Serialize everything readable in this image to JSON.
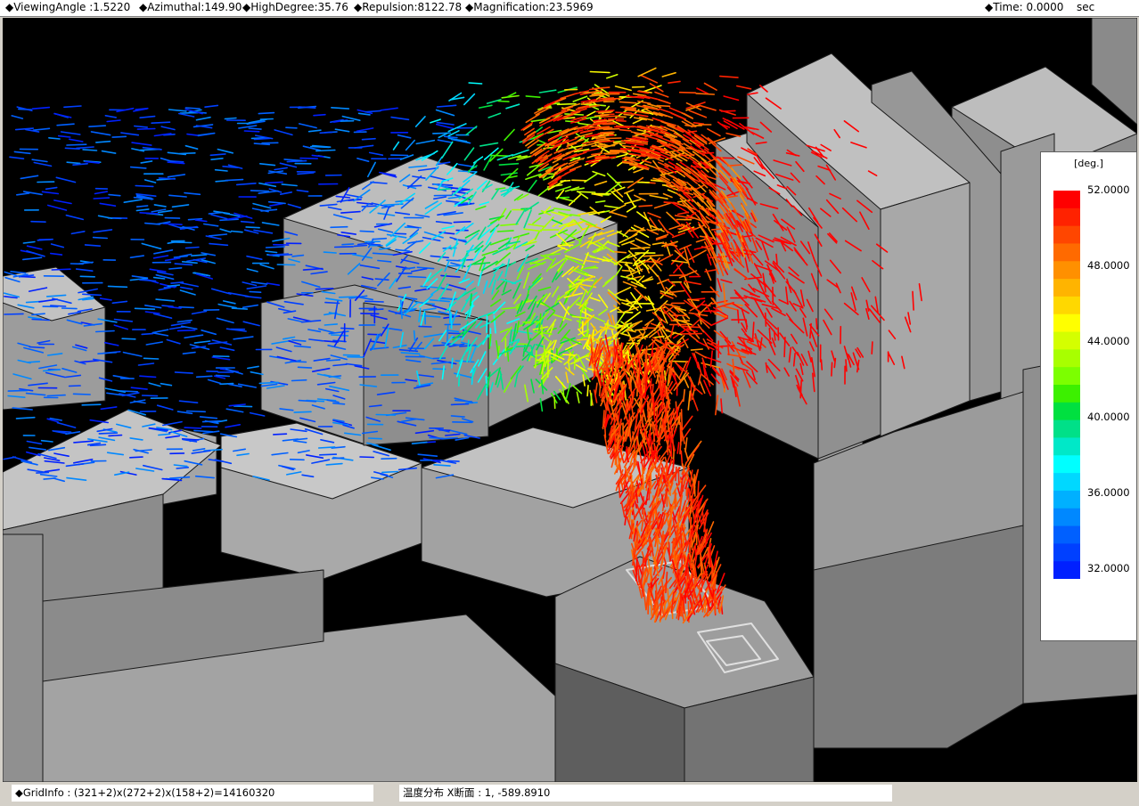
{
  "top_bar": {
    "viewing_angle": "◆ViewingAngle :1.5220",
    "azimuthal": "◆Azimuthal:149.90",
    "high_degree": "◆HighDegree:35.76",
    "repulsion": "◆Repulsion:8122.78",
    "magnification": "◆Magnification:23.5969",
    "time": "◆Time: 0.0000",
    "time_unit": "sec"
  },
  "legend": {
    "unit": "[deg.]",
    "min": 32,
    "max": 52,
    "labels": [
      "52.0000",
      "48.0000",
      "44.0000",
      "40.0000",
      "36.0000",
      "32.0000"
    ],
    "colors": [
      "#ff0000",
      "#ff2200",
      "#ff4600",
      "#ff6a00",
      "#ff9000",
      "#ffb400",
      "#ffd800",
      "#ffff00",
      "#d4ff00",
      "#a8ff00",
      "#7cff00",
      "#3cf000",
      "#00e040",
      "#00e088",
      "#00e8c8",
      "#00ffff",
      "#00d8ff",
      "#00b0ff",
      "#0088ff",
      "#0060ff",
      "#0040ff",
      "#0020ff"
    ]
  },
  "status_bar": {
    "grid_info": "◆GridInfo : (321+2)x(272+2)x(158+2)=14160320",
    "section_info": "温度分布 X断面 : 1,  -589.8910"
  }
}
